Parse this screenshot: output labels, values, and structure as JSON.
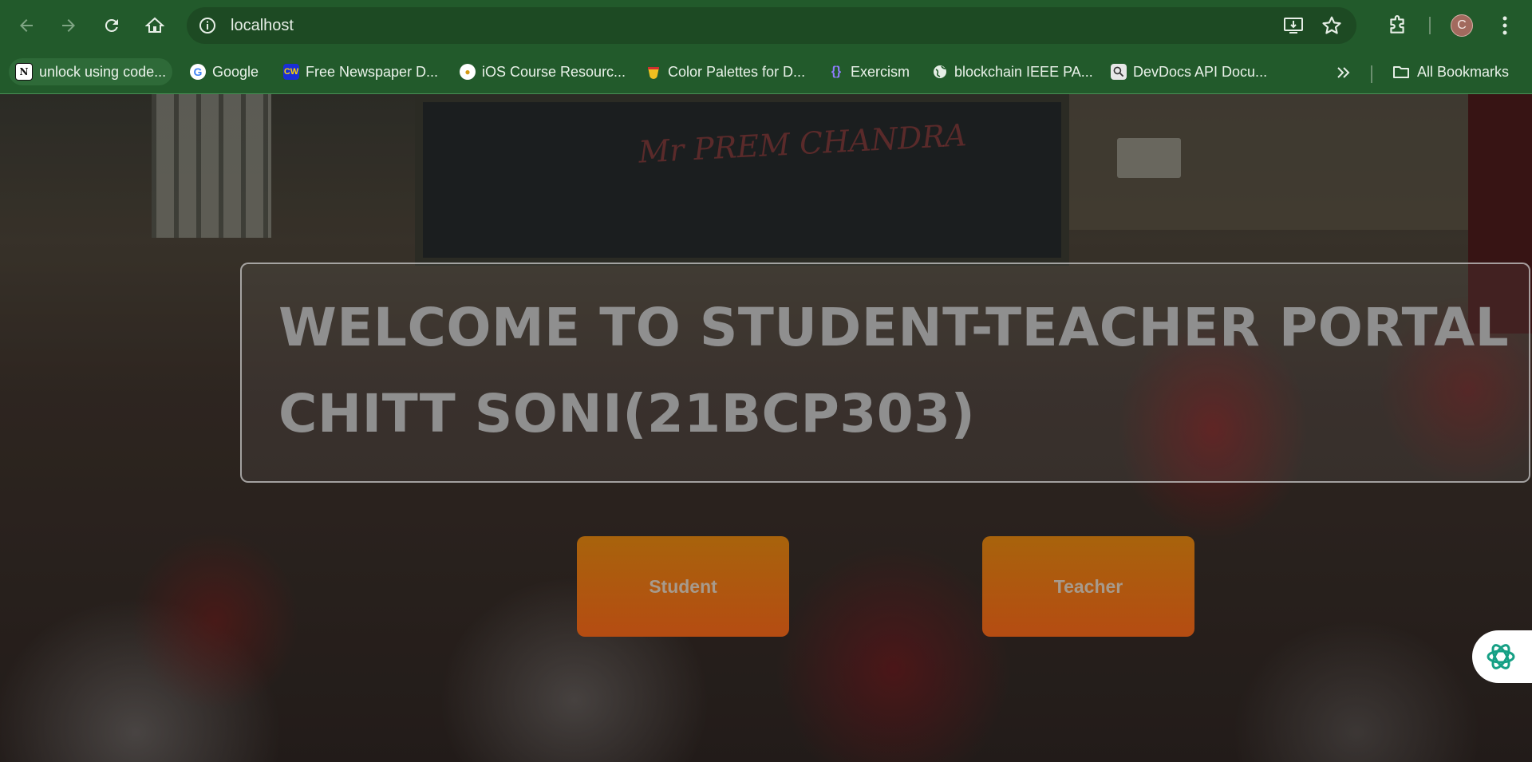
{
  "browser": {
    "url": "localhost",
    "profile_initial": "C",
    "bookmarks": [
      {
        "label": "unlock using code...",
        "icon": "notion-icon"
      },
      {
        "label": "Google",
        "icon": "google-icon"
      },
      {
        "label": "Free Newspaper D...",
        "icon": "cw-icon",
        "icon_text": "CW"
      },
      {
        "label": "iOS Course Resourc...",
        "icon": "ios-course-icon"
      },
      {
        "label": "Color Palettes for D...",
        "icon": "palette-icon"
      },
      {
        "label": "Exercism",
        "icon": "exercism-icon"
      },
      {
        "label": "blockchain IEEE PA...",
        "icon": "globe-icon"
      },
      {
        "label": "DevDocs API Docu...",
        "icon": "devdocs-icon"
      }
    ],
    "all_bookmarks_label": "All Bookmarks",
    "toolbar_color": "#225a2b"
  },
  "page": {
    "board_text": "Mr PREM CHANDRA",
    "welcome_title": "WELCOME TO STUDENT-TEACHER PORTAL",
    "author_line": "CHITT SONI(21BCP303)",
    "buttons": {
      "student": "Student",
      "teacher": "Teacher"
    },
    "button_color": "#b0550f",
    "ai_widget_icon": "openai-icon"
  }
}
